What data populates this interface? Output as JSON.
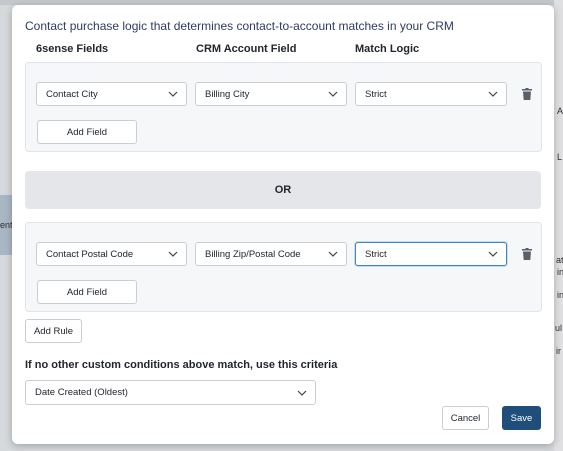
{
  "background": {
    "left_fragment": "ent",
    "right_fragments": [
      "A",
      "L",
      "at",
      "in",
      "in",
      "ul",
      "ir"
    ]
  },
  "modal": {
    "title": "Contact purchase logic that determines contact-to-account matches in your CRM",
    "columns": {
      "sixsense": "6sense Fields",
      "crm": "CRM Account Field",
      "match": "Match Logic"
    },
    "rules": [
      {
        "sixsense_field": "Contact City",
        "crm_field": "Billing City",
        "match_logic": "Strict",
        "add_field_label": "Add Field"
      },
      {
        "sixsense_field": "Contact Postal Code",
        "crm_field": "Billing Zip/Postal Code",
        "match_logic": "Strict",
        "add_field_label": "Add Field"
      }
    ],
    "or_label": "OR",
    "add_rule_label": "Add Rule",
    "criteria_label": "If no other custom conditions above match, use this criteria",
    "criteria_value": "Date Created (Oldest)",
    "cancel_label": "Cancel",
    "save_label": "Save"
  },
  "colors": {
    "primary": "#1f4e7a",
    "focus": "#3a86c8",
    "title_text": "#2f3b63"
  },
  "icons": {
    "dropdown": "chevron-down-icon",
    "delete": "trash-icon"
  }
}
